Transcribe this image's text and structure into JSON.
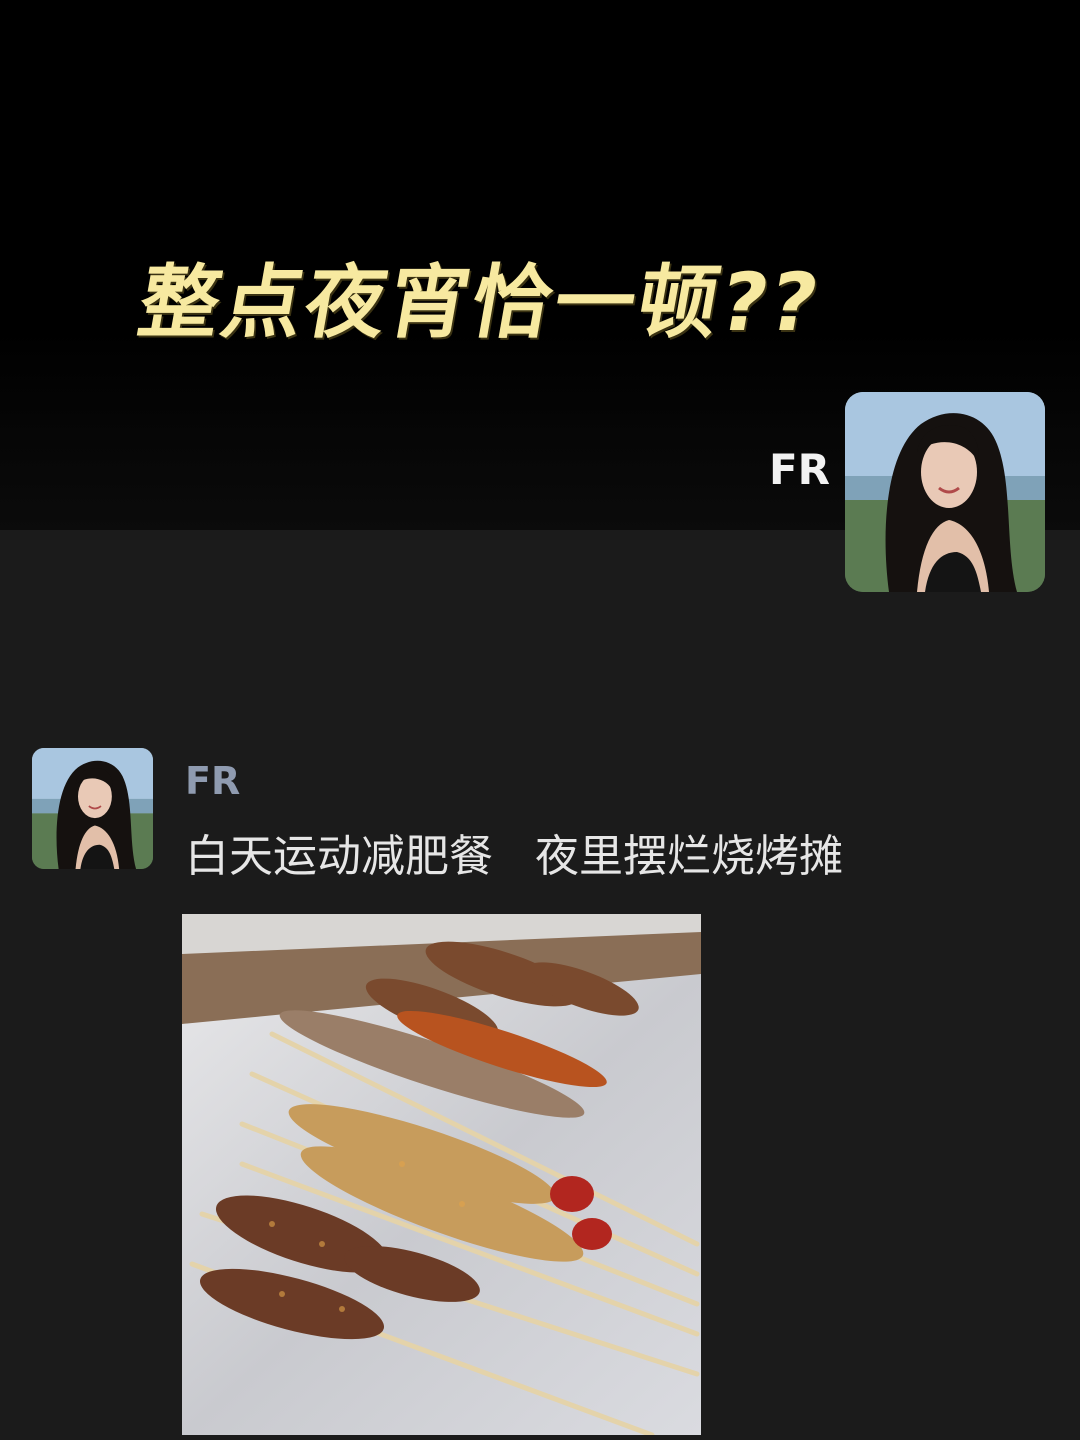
{
  "headline": "整点夜宵恰一顿??",
  "self": {
    "name": "FR",
    "avatar_icon": "profile-photo-icon"
  },
  "message": {
    "sender_name": "FR",
    "text": "白天运动减肥餐   夜里摆烂烧烤摊",
    "avatar_icon": "profile-photo-icon",
    "image_icon": "bbq-skewers-photo"
  },
  "colors": {
    "headline": "#f7e9a0",
    "background_top": "#000000",
    "background_chat": "#1b1b1b",
    "sender_name": "#8f9bb0",
    "message_text": "#e6e6e6"
  }
}
